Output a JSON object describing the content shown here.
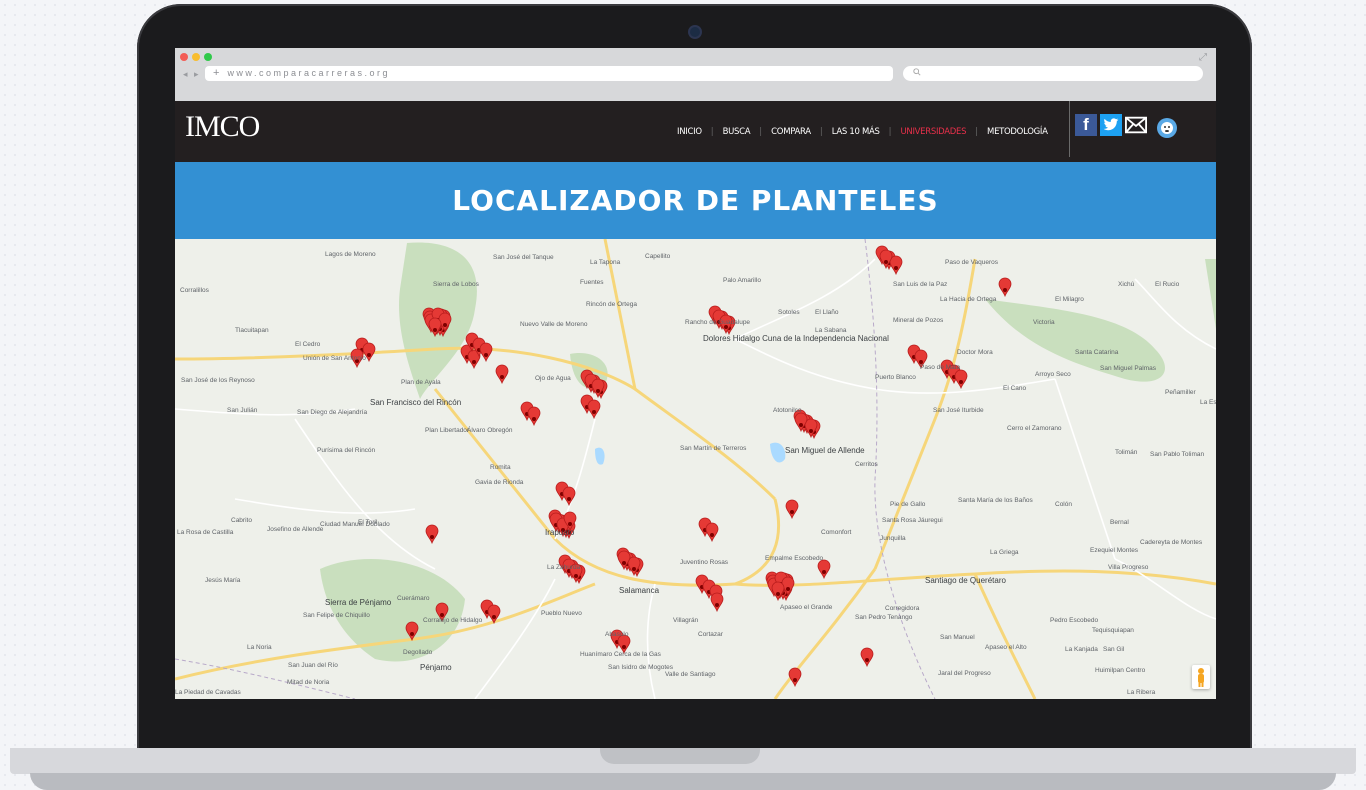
{
  "browser": {
    "back": "◂",
    "forward": "▸",
    "new_tab": "+",
    "url": "www.comparacarreras.org",
    "search_icon": "magnifier-icon"
  },
  "header": {
    "logo": "IMCO",
    "nav": [
      "INICIO",
      "BUSCA",
      "COMPARA",
      "LAS 10 MÁS",
      "UNIVERSIDADES",
      "METODOLOGÍA"
    ],
    "active_nav": "UNIVERSIDADES",
    "social": {
      "facebook": "f",
      "twitter": "twitter-bird-icon",
      "email": "envelope-icon",
      "avatar": "avatar-icon"
    }
  },
  "page": {
    "title": "LOCALIZADOR DE PLANTELES"
  },
  "colors": {
    "accent": "#3390d3",
    "header_bg": "#231f20",
    "active_nav": "#e8304a",
    "marker": "#e53935"
  },
  "map": {
    "places": [
      "Lagos de Moreno",
      "San José del Tanque",
      "La Tapona",
      "Capellito",
      "Sierra de Lobos",
      "Fuentes",
      "Rincón de Ortega",
      "Palo Amarillo",
      "Paso de Vaqueros",
      "San Luis de la Paz",
      "La Hacia de Ortega",
      "El Milagro",
      "Victoria",
      "Xichú",
      "El Rucio",
      "Corralillos",
      "Tlacuitapan",
      "El Cedro",
      "Unión de San Antonio",
      "San José de los Reynoso",
      "San Francisco del Rincón",
      "Nuevo Valle de Moreno",
      "Rancho de Guadalupe",
      "Dolores Hidalgo Cuna de la Independencia Nacional",
      "Sotoles",
      "El Llaño",
      "Mineral de Pozos",
      "La Sabana",
      "Doctor Mora",
      "Santa Catarina",
      "San Miguel Palmas",
      "Plan de Ayala",
      "Ojo de Agua",
      "Puerto Blanco",
      "Arroyo Seco",
      "El Cano",
      "Peñamiller",
      "La Estacada",
      "San Julián",
      "San Diego de Alejandría",
      "Plan Libertador",
      "Álvaro Obregón",
      "San José Iturbide",
      "Atotonilco",
      "Cerro el Zamorano",
      "Purísima del Rincón",
      "San Martín de Terreros",
      "San Miguel de Allende",
      "Cerritos",
      "Tolimán",
      "San Pablo Toliman",
      "Romita",
      "Gavia de Rionda",
      "Pie de Gallo",
      "Santa María de los Baños",
      "Cabrito",
      "Josefino de Allende",
      "Ciudad Manuel Doblado",
      "El Toril",
      "La Rosa de Castilla",
      "Irapuato",
      "Comonfort",
      "Santa Rosa Jáuregui",
      "Colón",
      "Bernal",
      "Juventino Rosas",
      "Empalme Escobedo",
      "Junquilla",
      "La Griega",
      "Ezequiel Montes",
      "Cadereyta de Montes",
      "Villa Progreso",
      "Jesús María",
      "Cuerámaro",
      "La Zahurda",
      "Salamanca",
      "Santiago de Querétaro",
      "Apaseo el Grande",
      "Corregidora",
      "Sierra de Pénjamo",
      "San Felipe de Chiquillo",
      "Corralejo de Hidalgo",
      "Pueblo Nuevo",
      "Villagrán",
      "Cortazar",
      "San Pedro Tenango",
      "Pedro Escobedo",
      "Tequisquiapan",
      "Abasolo",
      "San Manuel",
      "Apaseo el Alto",
      "La Kanjada",
      "San Gil",
      "La Noria",
      "Degollado",
      "Pénjamo",
      "Huanímaro Cerca de la Gas",
      "San Isidro de Mogotes",
      "Valle de Santiago",
      "Jaral del Progreso",
      "Huimilpan Centro",
      "San Juan del Río",
      "Mitad de Noria",
      "La Piedad de Cavadas",
      "La Ribera",
      "Paso de Mata"
    ],
    "marker_count": 140
  }
}
